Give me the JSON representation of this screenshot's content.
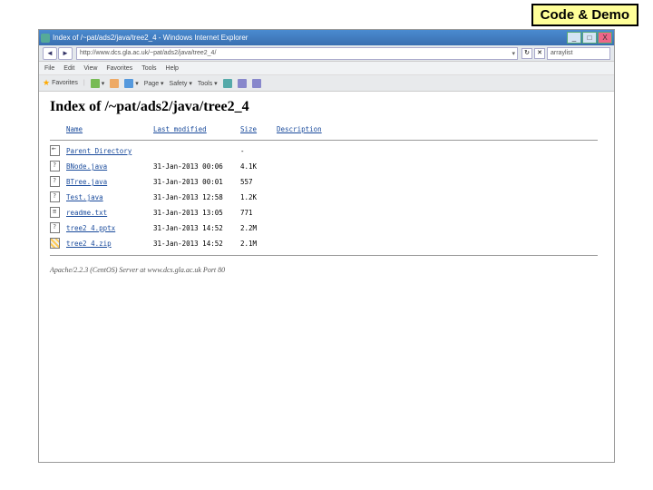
{
  "badge": "Code & Demo",
  "window": {
    "title": "Index of /~pat/ads2/java/tree2_4 - Windows Internet Explorer",
    "min": "_",
    "max": "□",
    "close": "X"
  },
  "address": {
    "nav_back": "◄",
    "nav_fwd": "►",
    "url": "http://www.dcs.gla.ac.uk/~pat/ads2/java/tree2_4/",
    "search_text": "arraylist",
    "refresh": "↻",
    "stop": "✕"
  },
  "menu": {
    "file": "File",
    "edit": "Edit",
    "view": "View",
    "favorites": "Favorites",
    "tools": "Tools",
    "help": "Help"
  },
  "toolbar": {
    "favorites": "Favorites",
    "home": "▾",
    "print": "▾",
    "page": "Page ▾",
    "safety": "Safety ▾",
    "tools_menu": "Tools ▾"
  },
  "page": {
    "heading": "Index of /~pat/ads2/java/tree2_4",
    "cols": {
      "name": "Name",
      "modified": "Last modified",
      "size": "Size",
      "desc": "Description"
    },
    "parent": {
      "label": "Parent Directory",
      "size": "-"
    },
    "files": [
      {
        "name": "BNode.java",
        "icon": "unk",
        "modified": "31-Jan-2013 00:06",
        "size": "4.1K"
      },
      {
        "name": "BTree.java",
        "icon": "unk",
        "modified": "31-Jan-2013 00:01",
        "size": "557"
      },
      {
        "name": "Test.java",
        "icon": "unk",
        "modified": "31-Jan-2013 12:58",
        "size": "1.2K"
      },
      {
        "name": "readme.txt",
        "icon": "txt",
        "modified": "31-Jan-2013 13:05",
        "size": "771"
      },
      {
        "name": "tree2_4.pptx",
        "icon": "unk",
        "modified": "31-Jan-2013 14:52",
        "size": "2.2M"
      },
      {
        "name": "tree2_4.zip",
        "icon": "zip",
        "modified": "31-Jan-2013 14:52",
        "size": "2.1M"
      }
    ],
    "footer": "Apache/2.2.3 (CentOS) Server at www.dcs.gla.ac.uk Port 80"
  }
}
